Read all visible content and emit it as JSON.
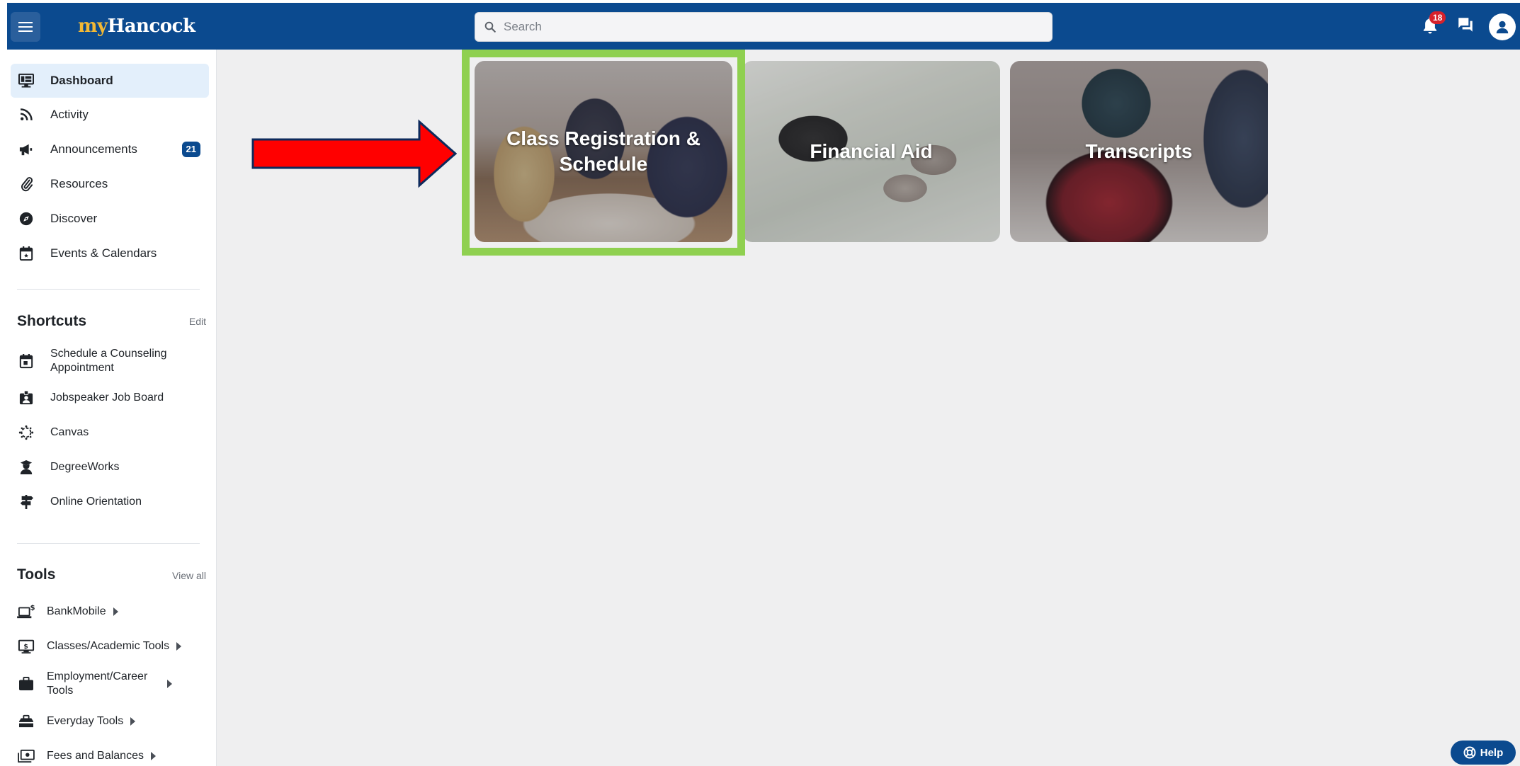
{
  "header": {
    "logo_my": "my",
    "logo_name": "Hancock",
    "search_placeholder": "Search",
    "notification_count": "18"
  },
  "sidebar": {
    "nav": [
      {
        "label": "Dashboard",
        "icon": "dashboard-icon",
        "active": true
      },
      {
        "label": "Activity",
        "icon": "rss-icon"
      },
      {
        "label": "Announcements",
        "icon": "megaphone-icon",
        "badge": "21"
      },
      {
        "label": "Resources",
        "icon": "paperclip-icon"
      },
      {
        "label": "Discover",
        "icon": "compass-icon"
      },
      {
        "label": "Events & Calendars",
        "icon": "calendar-icon"
      }
    ],
    "shortcuts": {
      "title": "Shortcuts",
      "edit_label": "Edit",
      "items": [
        {
          "label": "Schedule a Counseling Appointment",
          "icon": "calendar-icon"
        },
        {
          "label": "Jobspeaker Job Board",
          "icon": "id-badge-icon"
        },
        {
          "label": "Canvas",
          "icon": "canvas-icon"
        },
        {
          "label": "DegreeWorks",
          "icon": "graduate-icon"
        },
        {
          "label": "Online Orientation",
          "icon": "signpost-icon"
        }
      ]
    },
    "tools": {
      "title": "Tools",
      "view_all_label": "View all",
      "items": [
        {
          "label": "BankMobile",
          "icon": "laptop-dollar-icon"
        },
        {
          "label": "Classes/Academic Tools",
          "icon": "monitor-icon"
        },
        {
          "label": "Employment/Career Tools",
          "icon": "briefcase-icon"
        },
        {
          "label": "Everyday Tools",
          "icon": "toolbox-icon"
        },
        {
          "label": "Fees and Balances",
          "icon": "money-icon"
        }
      ]
    }
  },
  "main": {
    "cards": [
      {
        "title": "Class Registration & Schedule",
        "highlighted": true
      },
      {
        "title": "Financial Aid"
      },
      {
        "title": "Transcripts"
      }
    ]
  },
  "help_label": "Help",
  "colors": {
    "header_bg": "#0b4a8f",
    "logo_accent": "#f2b834",
    "highlight_border": "#8fd050",
    "arrow_fill": "#ff0000",
    "arrow_outline": "#0d2a5c",
    "notification_badge": "#d6212b"
  }
}
